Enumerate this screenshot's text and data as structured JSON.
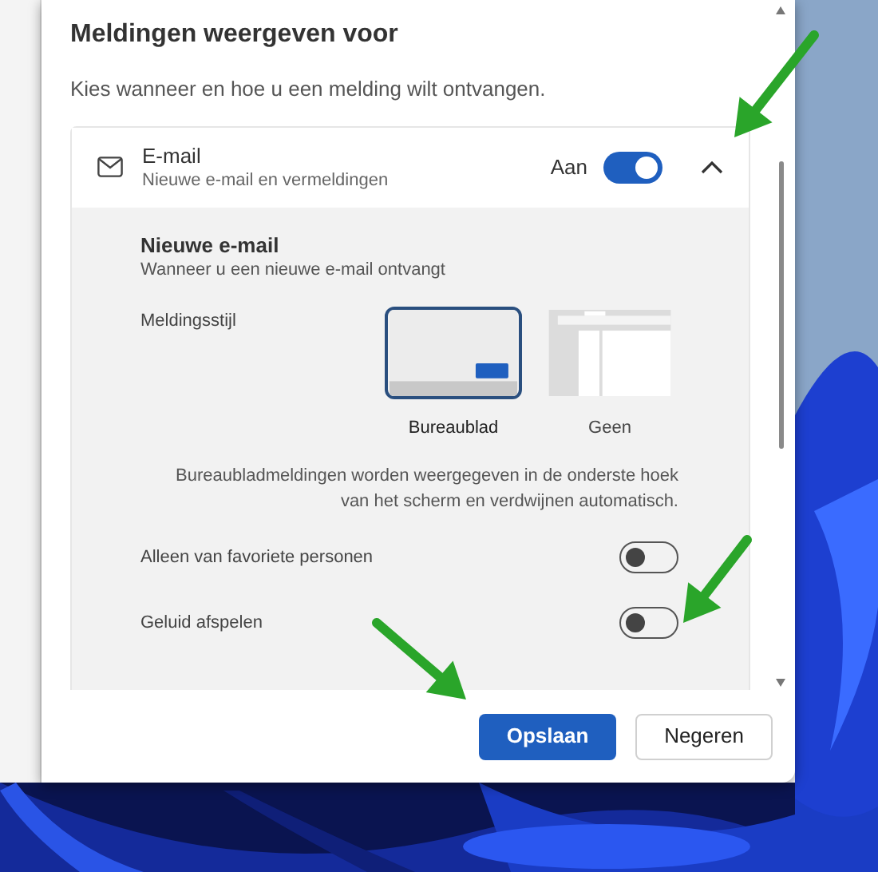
{
  "dialog": {
    "title": "Meldingen weergeven voor",
    "subtitle": "Kies wanneer en hoe u een melding wilt ontvangen."
  },
  "category": {
    "title": "E-mail",
    "subtitle": "Nieuwe e-mail en vermeldingen",
    "state_label": "Aan",
    "on": true,
    "expanded": true
  },
  "section": {
    "title": "Nieuwe e-mail",
    "subtitle": "Wanneer u een nieuwe e-mail ontvangt"
  },
  "style_label": "Meldingsstijl",
  "style_options": [
    {
      "kind": "desktop",
      "label": "Bureaublad",
      "selected": true
    },
    {
      "kind": "none",
      "label": "Geen",
      "selected": false
    }
  ],
  "style_description": "Bureaubladmeldingen worden weergegeven in de onderste hoek van het scherm en verdwijnen automatisch.",
  "toggles": [
    {
      "label": "Alleen van favoriete personen",
      "on": false
    },
    {
      "label": "Geluid afspelen",
      "on": false
    }
  ],
  "buttons": [
    {
      "label": "Opslaan",
      "kind": "primary"
    },
    {
      "label": "Negeren",
      "kind": "secondary"
    }
  ]
}
